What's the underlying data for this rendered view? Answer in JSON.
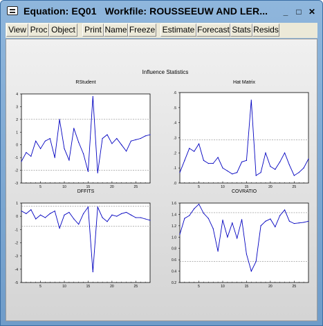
{
  "window": {
    "title": "Equation: EQ01   Workfile: ROUSSEEUW AND LER...",
    "minimize_glyph": "_",
    "maximize_glyph": "□",
    "close_glyph": "✕"
  },
  "toolbar": {
    "buttons": [
      "View",
      "Proc",
      "Object",
      "Print",
      "Name",
      "Freeze",
      "Estimate",
      "Forecast",
      "Stats",
      "Resids"
    ]
  },
  "graph": {
    "title": "Influence Statistics"
  },
  "colors": {
    "series": "#0000c0",
    "refline": "#888888"
  },
  "chart_data": [
    {
      "type": "line",
      "title": "RStudent",
      "x": [
        1,
        2,
        3,
        4,
        5,
        6,
        7,
        8,
        9,
        10,
        11,
        12,
        13,
        14,
        15,
        16,
        17,
        18,
        19,
        20,
        21,
        22,
        23,
        24,
        25,
        26,
        27,
        28
      ],
      "values": [
        -1.3,
        -0.6,
        -0.9,
        0.3,
        -0.3,
        0.3,
        0.5,
        -1.0,
        2.0,
        -0.3,
        -1.2,
        1.3,
        0.2,
        -0.7,
        -2.1,
        3.8,
        -2.2,
        0.5,
        0.8,
        0.1,
        0.5,
        0.0,
        -0.5,
        0.3,
        0.4,
        0.5,
        0.7,
        0.8
      ],
      "xticks": [
        5,
        10,
        15,
        20,
        25
      ],
      "yticks": [
        -3,
        -2,
        -1,
        0,
        1,
        2,
        3,
        4
      ],
      "ylim": [
        -3,
        4
      ],
      "xlim": [
        1,
        28
      ],
      "reflines": [
        -2,
        2
      ]
    },
    {
      "type": "line",
      "title": "Hat Matrix",
      "x": [
        1,
        2,
        3,
        4,
        5,
        6,
        7,
        8,
        9,
        10,
        11,
        12,
        13,
        14,
        15,
        16,
        17,
        18,
        19,
        20,
        21,
        22,
        23,
        24,
        25,
        26,
        27,
        28
      ],
      "values": [
        0.07,
        0.15,
        0.23,
        0.21,
        0.26,
        0.15,
        0.13,
        0.13,
        0.17,
        0.1,
        0.08,
        0.06,
        0.07,
        0.14,
        0.15,
        0.55,
        0.05,
        0.07,
        0.2,
        0.11,
        0.09,
        0.14,
        0.2,
        0.12,
        0.05,
        0.07,
        0.1,
        0.16
      ],
      "xticks": [
        5,
        10,
        15,
        20,
        25
      ],
      "yticks": [
        0.0,
        0.1,
        0.2,
        0.3,
        0.4,
        0.5,
        0.6
      ],
      "ytick_labels": [
        ".0",
        ".1",
        ".2",
        ".3",
        ".4",
        ".5",
        ".6"
      ],
      "ylim": [
        0,
        0.6
      ],
      "xlim": [
        1,
        28
      ],
      "reflines": [
        0.286
      ]
    },
    {
      "type": "line",
      "title": "DFFITS",
      "x": [
        1,
        2,
        3,
        4,
        5,
        6,
        7,
        8,
        9,
        10,
        11,
        12,
        13,
        14,
        15,
        16,
        17,
        18,
        19,
        20,
        21,
        22,
        23,
        24,
        25,
        26,
        27,
        28
      ],
      "values": [
        0.4,
        0.2,
        0.5,
        -0.2,
        0.1,
        -0.1,
        0.2,
        0.4,
        -0.9,
        0.1,
        0.3,
        -0.2,
        -0.6,
        0.2,
        0.7,
        -4.2,
        0.7,
        -0.1,
        -0.4,
        0.1,
        0.0,
        0.2,
        0.3,
        0.1,
        -0.1,
        -0.1,
        -0.2,
        -0.3
      ],
      "xticks": [
        5,
        10,
        15,
        20,
        25
      ],
      "yticks": [
        -5,
        -4,
        -3,
        -2,
        -1,
        0,
        1
      ],
      "ylim": [
        -5,
        1
      ],
      "xlim": [
        1,
        28
      ],
      "reflines": [
        0.76,
        -0.76
      ]
    },
    {
      "type": "line",
      "title": "COVRATIO",
      "x": [
        1,
        2,
        3,
        4,
        5,
        6,
        7,
        8,
        9,
        10,
        11,
        12,
        13,
        14,
        15,
        16,
        17,
        18,
        19,
        20,
        21,
        22,
        23,
        24,
        25,
        26,
        27,
        28
      ],
      "values": [
        1.05,
        1.33,
        1.38,
        1.5,
        1.58,
        1.42,
        1.33,
        1.15,
        0.75,
        1.3,
        1.0,
        1.25,
        0.98,
        1.31,
        0.7,
        0.4,
        0.57,
        1.2,
        1.28,
        1.32,
        1.18,
        1.38,
        1.48,
        1.28,
        1.24,
        1.25,
        1.26,
        1.28
      ],
      "xticks": [
        5,
        10,
        15,
        20,
        25
      ],
      "yticks": [
        0.2,
        0.4,
        0.6,
        0.8,
        1.0,
        1.2,
        1.4,
        1.6
      ],
      "ytick_labels": [
        "0.2",
        "0.4",
        "0.6",
        "0.8",
        "1.0",
        "1.2",
        "1.4",
        "1.6"
      ],
      "ylim": [
        0.2,
        1.6
      ],
      "xlim": [
        1,
        28
      ],
      "reflines": [
        1.43,
        0.57
      ]
    }
  ]
}
